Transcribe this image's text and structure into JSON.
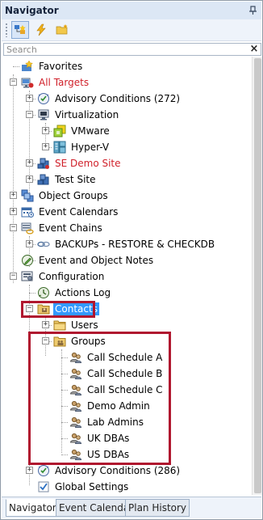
{
  "panel": {
    "title": "Navigator",
    "pin_icon": "pin-icon"
  },
  "toolbar": {
    "buttons": [
      {
        "name": "tree-view-icon"
      },
      {
        "name": "lightning-icon"
      },
      {
        "name": "folder-new-icon"
      }
    ]
  },
  "search": {
    "value": "",
    "placeholder": "Search",
    "clear_label": "×"
  },
  "tree": {
    "items": [
      {
        "label": "Favorites"
      },
      {
        "label": "All Targets"
      },
      {
        "label": "Advisory Conditions (272)"
      },
      {
        "label": "Virtualization"
      },
      {
        "label": "VMware"
      },
      {
        "label": "Hyper-V"
      },
      {
        "label": "SE Demo Site"
      },
      {
        "label": "Test Site"
      },
      {
        "label": "Object Groups"
      },
      {
        "label": "Event Calendars"
      },
      {
        "label": "Event Chains"
      },
      {
        "label": "BACKUPs - RESTORE & CHECKDB"
      },
      {
        "label": "Event and Object Notes"
      },
      {
        "label": "Configuration"
      },
      {
        "label": "Actions Log"
      },
      {
        "label": "Contacts"
      },
      {
        "label": "Users"
      },
      {
        "label": "Groups"
      },
      {
        "label": "Call Schedule A"
      },
      {
        "label": "Call Schedule B"
      },
      {
        "label": "Call Schedule C"
      },
      {
        "label": "Demo Admin"
      },
      {
        "label": "Lab Admins"
      },
      {
        "label": "UK DBAs"
      },
      {
        "label": "US DBAs"
      },
      {
        "label": "Advisory Conditions (286)"
      },
      {
        "label": "Global Settings"
      }
    ]
  },
  "tabs": [
    {
      "label": "Navigator"
    },
    {
      "label": "Event Calendar"
    },
    {
      "label": "Plan History"
    }
  ],
  "colors": {
    "selected": "#3399ff",
    "highlight_border": "#b0172f",
    "red_text": "#d0202a"
  }
}
